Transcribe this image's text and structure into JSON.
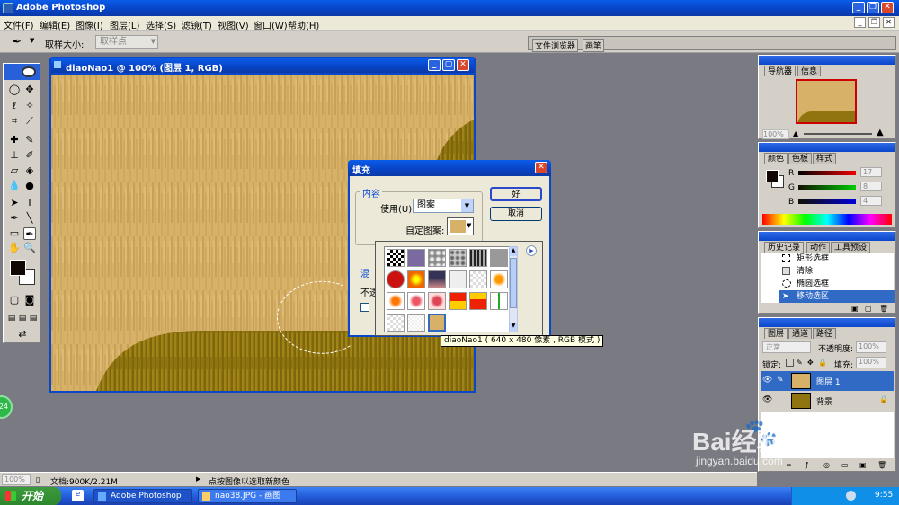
{
  "app": {
    "title": "Adobe Photoshop"
  },
  "menu": [
    "文件(F)",
    "编辑(E)",
    "图像(I)",
    "图层(L)",
    "选择(S)",
    "滤镜(T)",
    "视图(V)",
    "窗口(W)",
    "帮助(H)"
  ],
  "options": {
    "sample_label": "取样大小:",
    "sample_value": "取样点",
    "tab1": "文件浏览器",
    "tab2": "画笔"
  },
  "document": {
    "title": "diaoNao1 @ 100% (图层 1, RGB)"
  },
  "fill_dialog": {
    "title": "填充",
    "content_group": "内容",
    "use_label": "使用(U):",
    "use_value": "图案",
    "custom_pattern_label": "自定图案:",
    "ok": "好",
    "cancel": "取消",
    "blend_group_partial": "混",
    "opacity_partial": "不透",
    "tooltip": "diaoNao1 ( 640 x 480 像素 , RGB 模式 )"
  },
  "navigator": {
    "tabs": [
      "导航器",
      "信息"
    ],
    "zoom": "100%"
  },
  "color": {
    "tabs": [
      "颜色",
      "色板",
      "样式"
    ],
    "r": "17",
    "g": "8",
    "b": "4",
    "r_label": "R",
    "g_label": "G",
    "b_label": "B"
  },
  "history": {
    "tabs": [
      "历史记录",
      "动作",
      "工具预设"
    ],
    "items": [
      "矩形选框",
      "清除",
      "椭圆选框",
      "移动选区"
    ]
  },
  "layers": {
    "tabs": [
      "图层",
      "通道",
      "路径"
    ],
    "blend_mode": "正常",
    "opacity_label": "不透明度:",
    "opacity_value": "100%",
    "lock_label": "锁定:",
    "fill_label": "填充:",
    "fill_value": "100%",
    "items": [
      "图层 1",
      "背景"
    ]
  },
  "status": {
    "zoom": "100%",
    "doc_info": "文档:900K/2.21M",
    "hint": "点按图像以选取新颜色"
  },
  "taskbar": {
    "start": "开始",
    "task1": "Adobe Photoshop",
    "task2": "nao38.JPG - 画图",
    "clock": "9:55"
  },
  "badge": "24",
  "watermark": {
    "text": "Bai经验",
    "url": "jingyan.baidu.com"
  },
  "colors": {
    "wood_light": "#d8b168",
    "wood_dark": "#8f7410",
    "xp_blue": "#0a4fd8",
    "selected": "#316ac5"
  }
}
